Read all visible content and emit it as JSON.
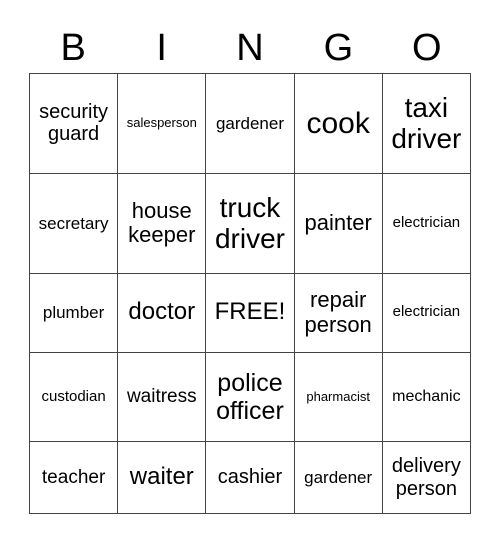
{
  "header": [
    "B",
    "I",
    "N",
    "G",
    "O"
  ],
  "rows": [
    [
      "security guard",
      "salesperson",
      "gardener",
      "cook",
      "taxi driver"
    ],
    [
      "secretary",
      "house keeper",
      "truck driver",
      "painter",
      "electrician"
    ],
    [
      "plumber",
      "doctor",
      "FREE!",
      "repair person",
      "electrician"
    ],
    [
      "custodian",
      "waitress",
      "police officer",
      "pharmacist",
      "mechanic"
    ],
    [
      "teacher",
      "waiter",
      "cashier",
      "gardener",
      "delivery person"
    ]
  ]
}
